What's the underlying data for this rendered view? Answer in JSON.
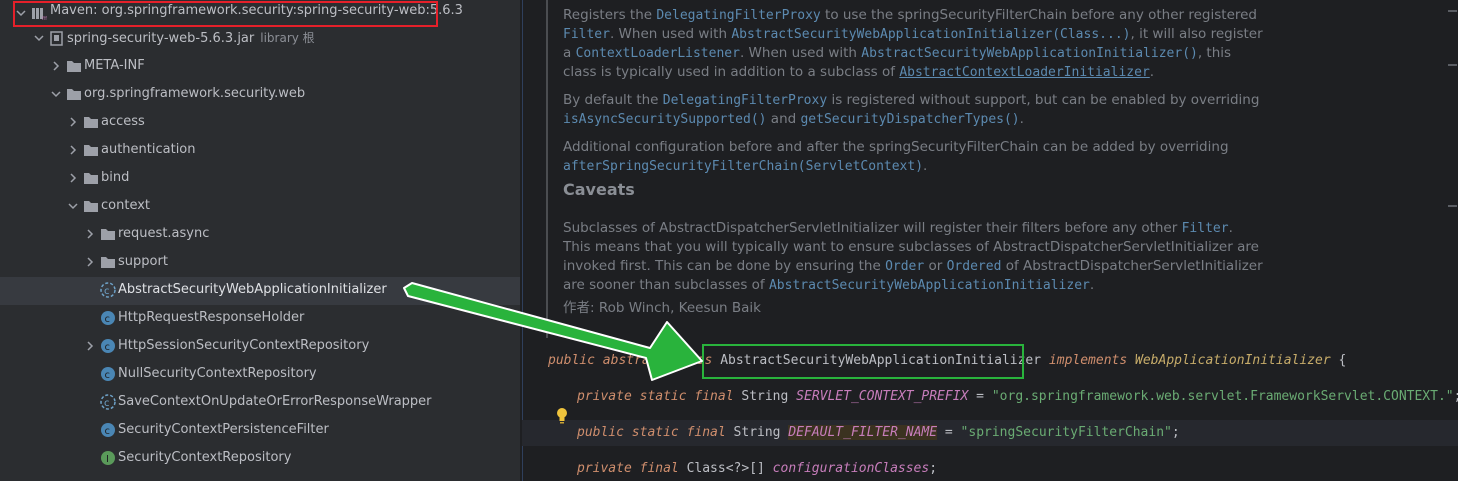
{
  "tree": {
    "items": [
      {
        "label": "Maven: org.springframework.security:spring-security-web:5.6.3",
        "icon": "maven-library-icon",
        "expanded": true
      },
      {
        "label": "spring-security-web-5.6.3.jar",
        "suffix": "library 根",
        "icon": "jar-icon",
        "expanded": true
      },
      {
        "label": "META-INF",
        "icon": "folder-icon",
        "expanded": false
      },
      {
        "label": "org.springframework.security.web",
        "icon": "package-icon",
        "expanded": true
      },
      {
        "label": "access",
        "icon": "package-icon",
        "expanded": false
      },
      {
        "label": "authentication",
        "icon": "package-icon",
        "expanded": false
      },
      {
        "label": "bind",
        "icon": "package-icon",
        "expanded": false
      },
      {
        "label": "context",
        "icon": "package-icon",
        "expanded": true
      },
      {
        "label": "request.async",
        "icon": "package-icon",
        "expanded": false
      },
      {
        "label": "support",
        "icon": "package-icon",
        "expanded": false
      },
      {
        "label": "AbstractSecurityWebApplicationInitializer",
        "icon": "abstract-class-icon",
        "selected": true
      },
      {
        "label": "HttpRequestResponseHolder",
        "icon": "class-icon"
      },
      {
        "label": "HttpSessionSecurityContextRepository",
        "icon": "class-icon",
        "expanded": false
      },
      {
        "label": "NullSecurityContextRepository",
        "icon": "class-icon"
      },
      {
        "label": "SaveContextOnUpdateOrErrorResponseWrapper",
        "icon": "abstract-class-icon"
      },
      {
        "label": "SecurityContextPersistenceFilter",
        "icon": "class-icon"
      },
      {
        "label": "SecurityContextRepository",
        "icon": "interface-icon"
      }
    ]
  },
  "doc": {
    "p1": [
      "Registers the ",
      "DelegatingFilterProxy",
      " to use the springSecurityFilterChain before any other registered ",
      "Filter",
      ". When used with ",
      "AbstractSecurityWebApplicationInitializer(Class...)",
      ", it will also register a ",
      "ContextLoaderListener",
      ". When used with ",
      "AbstractSecurityWebApplicationInitializer()",
      ", this class is typically used in addition to a subclass of ",
      "AbstractContextLoaderInitializer",
      "."
    ],
    "p2": [
      "By default the ",
      "DelegatingFilterProxy",
      " is registered without support, but can be enabled by overriding ",
      "isAsyncSecuritySupported()",
      " and ",
      "getSecurityDispatcherTypes()",
      "."
    ],
    "p3": [
      "Additional configuration before and after the springSecurityFilterChain can be added by overriding ",
      "afterSpringSecurityFilterChain(ServletContext)",
      "."
    ],
    "caveats": "Caveats",
    "p4": [
      "Subclasses of AbstractDispatcherServletInitializer will register their filters before any other ",
      "Filter",
      ". This means that you will typically want to ensure subclasses of AbstractDispatcherServletInitializer are invoked first. This can be done by ensuring the ",
      "Order",
      " or ",
      "Ordered",
      " of AbstractDispatcherServletInitializer are sooner than subclasses of ",
      "AbstractSecurityWebApplicationInitializer",
      "."
    ],
    "author": "作者: Rob Winch, Keesun Baik"
  },
  "code": {
    "l1": [
      "public abstract class ",
      "AbstractSecurityWebApplicationInitializer",
      " implements ",
      "WebApplicationInitializer",
      " {"
    ],
    "l2": [
      "private static final ",
      "String ",
      "SERVLET_CONTEXT_PREFIX",
      " = ",
      "\"org.springframework.web.servlet.FrameworkServlet.CONTEXT.\"",
      ";"
    ],
    "l3": [
      "public static final ",
      "String ",
      "DEFAULT_FILTER_NAME",
      " = ",
      "\"springSecurityFilterChain\"",
      ";"
    ],
    "l4": [
      "private final ",
      "Class<?>[] ",
      "configurationClasses",
      ";"
    ]
  },
  "colors": {
    "red_box": "#e5202a",
    "green_box": "#29b33c",
    "arrow": "#29b33c"
  }
}
